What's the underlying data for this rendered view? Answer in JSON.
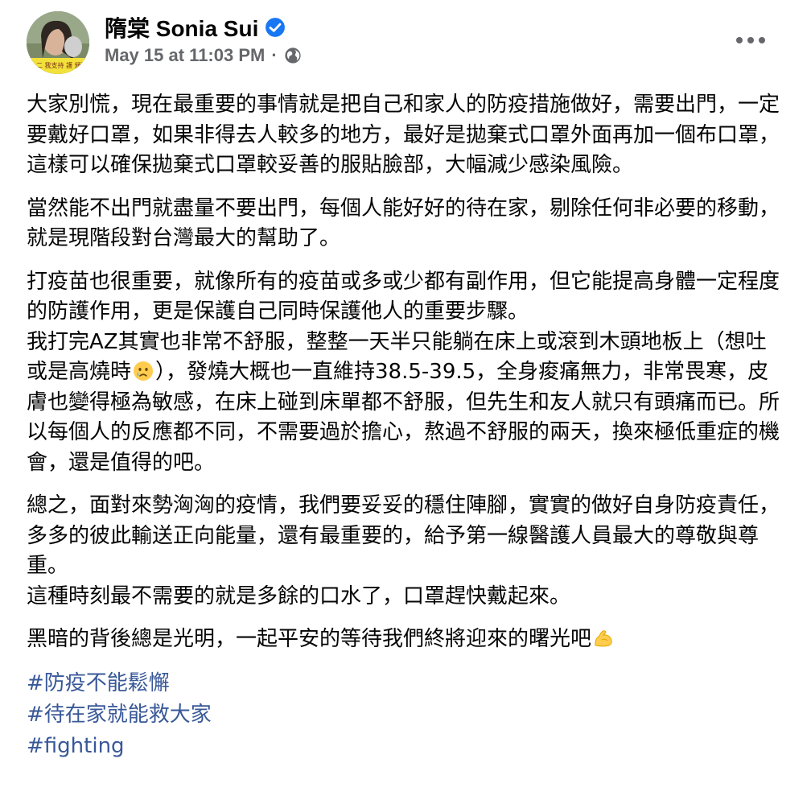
{
  "post": {
    "author": "隋棠 Sonia Sui",
    "verified": true,
    "timestamp": "May 15 at 11:03 PM",
    "separator": "·",
    "audience_icon": "globe-icon",
    "more_icon": "more-options-icon",
    "avatar_sign_text": "十二 我支持 護 頒獲 不",
    "paragraphs": [
      "大家別慌，現在最重要的事情就是把自己和家人的防疫措施做好，需要出門，一定要戴好口罩，如果非得去人較多的地方，最好是拋棄式口罩外面再加一個布口罩，這樣可以確保拋棄式口罩較妥善的服貼臉部，大幅減少感染風險。",
      "當然能不出門就盡量不要出門，每個人能好好的待在家，剔除任何非必要的移動，就是現階段對台灣最大的幫助了。",
      "打疫苗也很重要，就像所有的疫苗或多或少都有副作用，但它能提高身體一定程度的防護作用，更是保護自己同時保護他人的重要步驟。\n我打完AZ其實也非常不舒服，整整一天半只能躺在床上或滾到木頭地板上（想吐或是高燒時",
      "），發燒大概也一直維持38.5-39.5，全身痠痛無力，非常畏寒，皮膚也變得極為敏感，在床上碰到床單都不舒服，但先生和友人就只有頭痛而已。所以每個人的反應都不同，不需要過於擔心，熬過不舒服的兩天，換來極低重症的機會，還是值得的吧。",
      "總之，面對來勢洶洶的疫情，我們要妥妥的穩住陣腳，實實的做好自身防疫責任，多多的彼此輸送正向能量，還有最重要的，給予第一線醫護人員最大的尊敬與尊重。\n這種時刻最不需要的就是多餘的口水了，口罩趕快戴起來。",
      "黑暗的背後總是光明，一起平安的等待我們終將迎來的曙光吧"
    ],
    "emojis": [
      "crying-face-emoji",
      "flexed-biceps-emoji"
    ],
    "hashtags": [
      "#防疫不能鬆懈",
      "#待在家就能救大家",
      "#fighting"
    ]
  },
  "colors": {
    "link": "#385898",
    "meta": "#65676b",
    "verified": "#1877f2",
    "text": "#050505"
  }
}
